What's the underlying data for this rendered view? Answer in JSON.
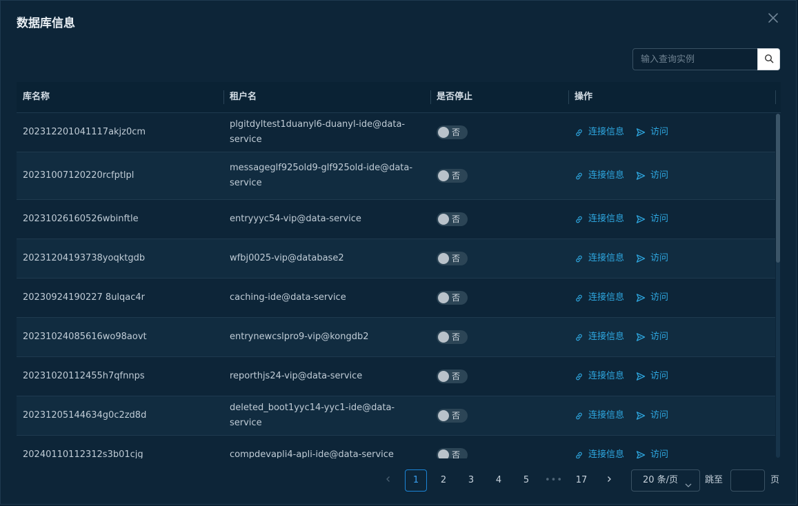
{
  "dialog": {
    "title": "数据库信息",
    "close_icon": "close-icon"
  },
  "search": {
    "placeholder": "输入查询实例",
    "value": "",
    "icon": "search-icon"
  },
  "table": {
    "columns": [
      "库名称",
      "租户名",
      "是否停止",
      "操作"
    ],
    "rows": [
      {
        "name": "20231220104111­7akjz0cm",
        "tenant": "plgitdyltest1duanyl6-duanyl-ide@data-service",
        "stopped": "否",
        "action_connect": "连接信息",
        "action_visit": "访问"
      },
      {
        "name": "20231007120220rcfptlpl",
        "tenant": "messageglf925old9-glf925old-ide@data-service",
        "stopped": "否",
        "action_connect": "连接信息",
        "action_visit": "访问"
      },
      {
        "name": "20231026160526wbinftle",
        "tenant": "entryyyc54-vip@data-service",
        "stopped": "否",
        "action_connect": "连接信息",
        "action_visit": "访问"
      },
      {
        "name": "20231204193738yoqktgdb",
        "tenant": "wfbj0025-vip@database2",
        "stopped": "否",
        "action_connect": "连接信息",
        "action_visit": "访问"
      },
      {
        "name": "20230924190227 8ulqac4r",
        "tenant": "caching-ide@data-service",
        "stopped": "否",
        "action_connect": "连接信息",
        "action_visit": "访问"
      },
      {
        "name": "20231024085616wo98aovt",
        "tenant": "entrynewcslpro9-vip@kongdb2",
        "stopped": "否",
        "action_connect": "连接信息",
        "action_visit": "访问"
      },
      {
        "name": "20231020112455h7qfnnps",
        "tenant": "reporthjs24-vip@data-service",
        "stopped": "否",
        "action_connect": "连接信息",
        "action_visit": "访问"
      },
      {
        "name": "20231205144634g0c2zd8d",
        "tenant": "deleted_boot1yyc14-yyc1-ide@data-service",
        "stopped": "否",
        "action_connect": "连接信息",
        "action_visit": "访问"
      },
      {
        "name": "20240110112312s3b01cjg",
        "tenant": "compdevapli4-apli-ide@data-service",
        "stopped": "否",
        "action_connect": "连接信息",
        "action_visit": "访问"
      }
    ]
  },
  "pagination": {
    "prev_icon": "chevron-left-icon",
    "next_icon": "chevron-right-icon",
    "pages": [
      "1",
      "2",
      "3",
      "4",
      "5",
      "•••",
      "17"
    ],
    "current": "1",
    "page_size": "20 条/页",
    "jump_label": "跳至",
    "jump_value": "",
    "page_label": "页"
  },
  "colors": {
    "background": "#0d2538",
    "accent": "#2ea7e0",
    "active_page": "#1b86d8"
  }
}
